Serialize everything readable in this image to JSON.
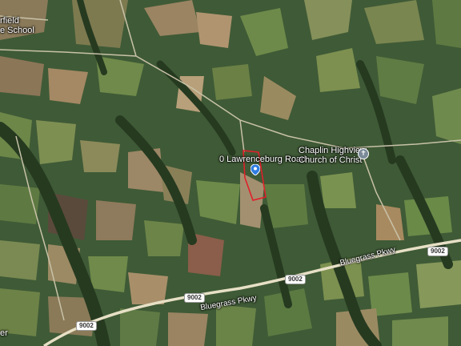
{
  "map": {
    "type": "satellite",
    "colors": {
      "base": "#3f5a36",
      "field_light": "#8a8a56",
      "field_tan": "#b09470",
      "field_green": "#5d7a43",
      "forest_dark": "#2a3d22",
      "road": "#e7e0c6",
      "parcel_outline": "#e0202a",
      "pin": "#2f7de1"
    }
  },
  "labels": {
    "school_partial_line1": "rfield",
    "school_partial_line2": "e School",
    "parcel_address": "0 Lawrenceburg Road",
    "church_line1": "Chaplin Highview",
    "church_line2": "Church of Christ",
    "corner_partial": "er"
  },
  "roads": {
    "parkway_name": "Bluegrass Pkwy",
    "route_number": "9002"
  },
  "icons": {
    "parcel_pin": "location-pin-icon",
    "church": "church-cross-icon"
  }
}
